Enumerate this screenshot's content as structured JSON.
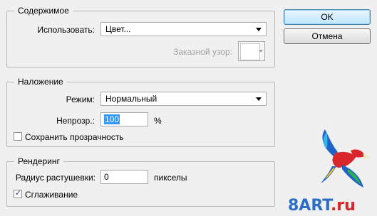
{
  "groups": {
    "contents": {
      "title": "Содержимое",
      "use_label": "Использовать:",
      "use_value": "Цвет...",
      "custom_pattern_label": "Заказной узор:"
    },
    "blending": {
      "title": "Наложение",
      "mode_label": "Режим:",
      "mode_value": "Нормальный",
      "opacity_label": "Непрозр.:",
      "opacity_value": "100",
      "opacity_unit": "%",
      "preserve_transparency_label": "Сохранить прозрачность",
      "preserve_transparency_checked": false
    },
    "rendering": {
      "title": "Рендеринг",
      "feather_label": "Радиус растушевки:",
      "feather_value": "0",
      "feather_unit": "пикселы",
      "antialias_label": "Сглаживание",
      "antialias_checked": true
    }
  },
  "buttons": {
    "ok": "OK",
    "cancel": "Отмена"
  },
  "watermark": {
    "text_main": "8ART",
    "text_suffix": ".ru"
  },
  "colors": {
    "watermark_blue": "#2b6cc4",
    "watermark_red": "#d8262b",
    "selection": "#3399ff"
  },
  "icons": {
    "check": "✓"
  }
}
